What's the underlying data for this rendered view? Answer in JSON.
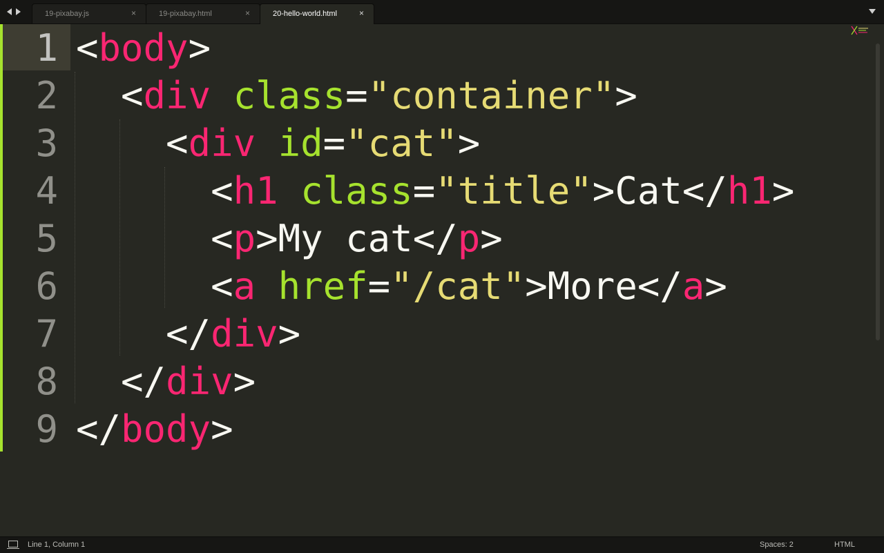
{
  "tabs": [
    {
      "label": "19-pixabay.js",
      "close": "×",
      "active": false
    },
    {
      "label": "19-pixabay.html",
      "close": "×",
      "active": false
    },
    {
      "label": "20-hello-world.html",
      "close": "×",
      "active": true
    }
  ],
  "editor": {
    "line_numbers": [
      "1",
      "2",
      "3",
      "4",
      "5",
      "6",
      "7",
      "8",
      "9"
    ],
    "code_lines": [
      [
        {
          "t": "<",
          "c": "p"
        },
        {
          "t": "body",
          "c": "tag"
        },
        {
          "t": ">",
          "c": "p"
        }
      ],
      [
        {
          "t": "  ",
          "c": "p"
        },
        {
          "t": "<",
          "c": "p"
        },
        {
          "t": "div",
          "c": "tag"
        },
        {
          "t": " ",
          "c": "p"
        },
        {
          "t": "class",
          "c": "attr"
        },
        {
          "t": "=",
          "c": "p"
        },
        {
          "t": "\"container\"",
          "c": "str"
        },
        {
          "t": ">",
          "c": "p"
        }
      ],
      [
        {
          "t": "    ",
          "c": "p"
        },
        {
          "t": "<",
          "c": "p"
        },
        {
          "t": "div",
          "c": "tag"
        },
        {
          "t": " ",
          "c": "p"
        },
        {
          "t": "id",
          "c": "attr"
        },
        {
          "t": "=",
          "c": "p"
        },
        {
          "t": "\"cat\"",
          "c": "str"
        },
        {
          "t": ">",
          "c": "p"
        }
      ],
      [
        {
          "t": "      ",
          "c": "p"
        },
        {
          "t": "<",
          "c": "p"
        },
        {
          "t": "h1",
          "c": "tag"
        },
        {
          "t": " ",
          "c": "p"
        },
        {
          "t": "class",
          "c": "attr"
        },
        {
          "t": "=",
          "c": "p"
        },
        {
          "t": "\"title\"",
          "c": "str"
        },
        {
          "t": ">",
          "c": "p"
        },
        {
          "t": "Cat",
          "c": "p"
        },
        {
          "t": "</",
          "c": "p"
        },
        {
          "t": "h1",
          "c": "tag"
        },
        {
          "t": ">",
          "c": "p"
        }
      ],
      [
        {
          "t": "      ",
          "c": "p"
        },
        {
          "t": "<",
          "c": "p"
        },
        {
          "t": "p",
          "c": "tag"
        },
        {
          "t": ">",
          "c": "p"
        },
        {
          "t": "My cat",
          "c": "p"
        },
        {
          "t": "</",
          "c": "p"
        },
        {
          "t": "p",
          "c": "tag"
        },
        {
          "t": ">",
          "c": "p"
        }
      ],
      [
        {
          "t": "      ",
          "c": "p"
        },
        {
          "t": "<",
          "c": "p"
        },
        {
          "t": "a",
          "c": "tag"
        },
        {
          "t": " ",
          "c": "p"
        },
        {
          "t": "href",
          "c": "attr"
        },
        {
          "t": "=",
          "c": "p"
        },
        {
          "t": "\"/cat\"",
          "c": "str"
        },
        {
          "t": ">",
          "c": "p"
        },
        {
          "t": "More",
          "c": "p"
        },
        {
          "t": "</",
          "c": "p"
        },
        {
          "t": "a",
          "c": "tag"
        },
        {
          "t": ">",
          "c": "p"
        }
      ],
      [
        {
          "t": "    ",
          "c": "p"
        },
        {
          "t": "</",
          "c": "p"
        },
        {
          "t": "div",
          "c": "tag"
        },
        {
          "t": ">",
          "c": "p"
        }
      ],
      [
        {
          "t": "  ",
          "c": "p"
        },
        {
          "t": "</",
          "c": "p"
        },
        {
          "t": "div",
          "c": "tag"
        },
        {
          "t": ">",
          "c": "p"
        }
      ],
      [
        {
          "t": "</",
          "c": "p"
        },
        {
          "t": "body",
          "c": "tag"
        },
        {
          "t": ">",
          "c": "p"
        }
      ]
    ],
    "current_line": 1,
    "colors": {
      "background": "#272822",
      "tag": "#f92672",
      "attribute": "#a6e22e",
      "string": "#e6db74",
      "text": "#f8f8f2",
      "modified_marker": "#a6e22e"
    }
  },
  "status": {
    "position": "Line 1, Column 1",
    "spaces": "Spaces: 2",
    "syntax": "HTML"
  }
}
